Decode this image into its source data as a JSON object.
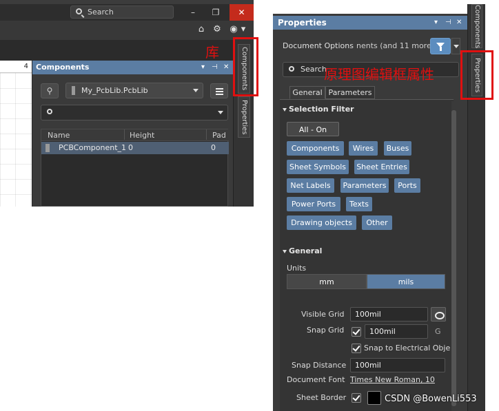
{
  "left": {
    "search_text": "Search",
    "win": {
      "minimize": "–",
      "maximize": "❐",
      "close": "✕"
    },
    "toolbar": {
      "home_icon": "⌂",
      "gear_icon": "⚙",
      "user_icon": "◉",
      "user_caret": "▾"
    },
    "ruler_value": "4",
    "panel_title": "Components",
    "panel_ctrl_down": "▾",
    "panel_ctrl_pin": "⊣",
    "panel_ctrl_close": "✕",
    "filter_icon": "⚲",
    "library_selected": "My_PcbLib.PcbLib",
    "table": {
      "headers": [
        "Name",
        "Height",
        "Pad"
      ],
      "rows": [
        {
          "name": "PCBComponent_1",
          "height": "0",
          "pad": "0"
        }
      ]
    },
    "vertical_tabs": [
      "Components",
      "Properties"
    ],
    "annotation": "库"
  },
  "right": {
    "panel_title": "Properties",
    "panel_ctrl_down": "▾",
    "panel_ctrl_pin": "⊣",
    "panel_ctrl_close": "✕",
    "document_options": "Document Options",
    "document_options_more": "nents (and 11 more)",
    "search_text": "Search",
    "annotation": "原理图编辑框属性",
    "tabs": [
      "General",
      "Parameters"
    ],
    "selection_filter": {
      "title": "Selection Filter",
      "all_label": "All - On",
      "chips": [
        "Components",
        "Wires",
        "Buses",
        "Sheet Symbols",
        "Sheet Entries",
        "Net Labels",
        "Parameters",
        "Ports",
        "Power Ports",
        "Texts",
        "Drawing objects",
        "Other"
      ]
    },
    "general": {
      "title": "General",
      "units_label": "Units",
      "units": [
        "mm",
        "mils"
      ],
      "units_selected": "mils",
      "visible_grid_label": "Visible Grid",
      "visible_grid_value": "100mil",
      "snap_grid_label": "Snap Grid",
      "snap_grid_value": "100mil",
      "snap_grid_key": "G",
      "snap_electrical_label": "Snap to Electrical Obje",
      "snap_distance_label": "Snap Distance",
      "snap_distance_value": "100mil",
      "document_font_label": "Document Font",
      "document_font_value": "Times New Roman, 10",
      "sheet_border_label": "Sheet Border"
    },
    "vertical_tabs": [
      "Components",
      "Properties"
    ]
  },
  "watermark": "CSDN @BowenLi553",
  "colors": {
    "accent": "#5b7da3",
    "annotation_red": "#e01010"
  }
}
